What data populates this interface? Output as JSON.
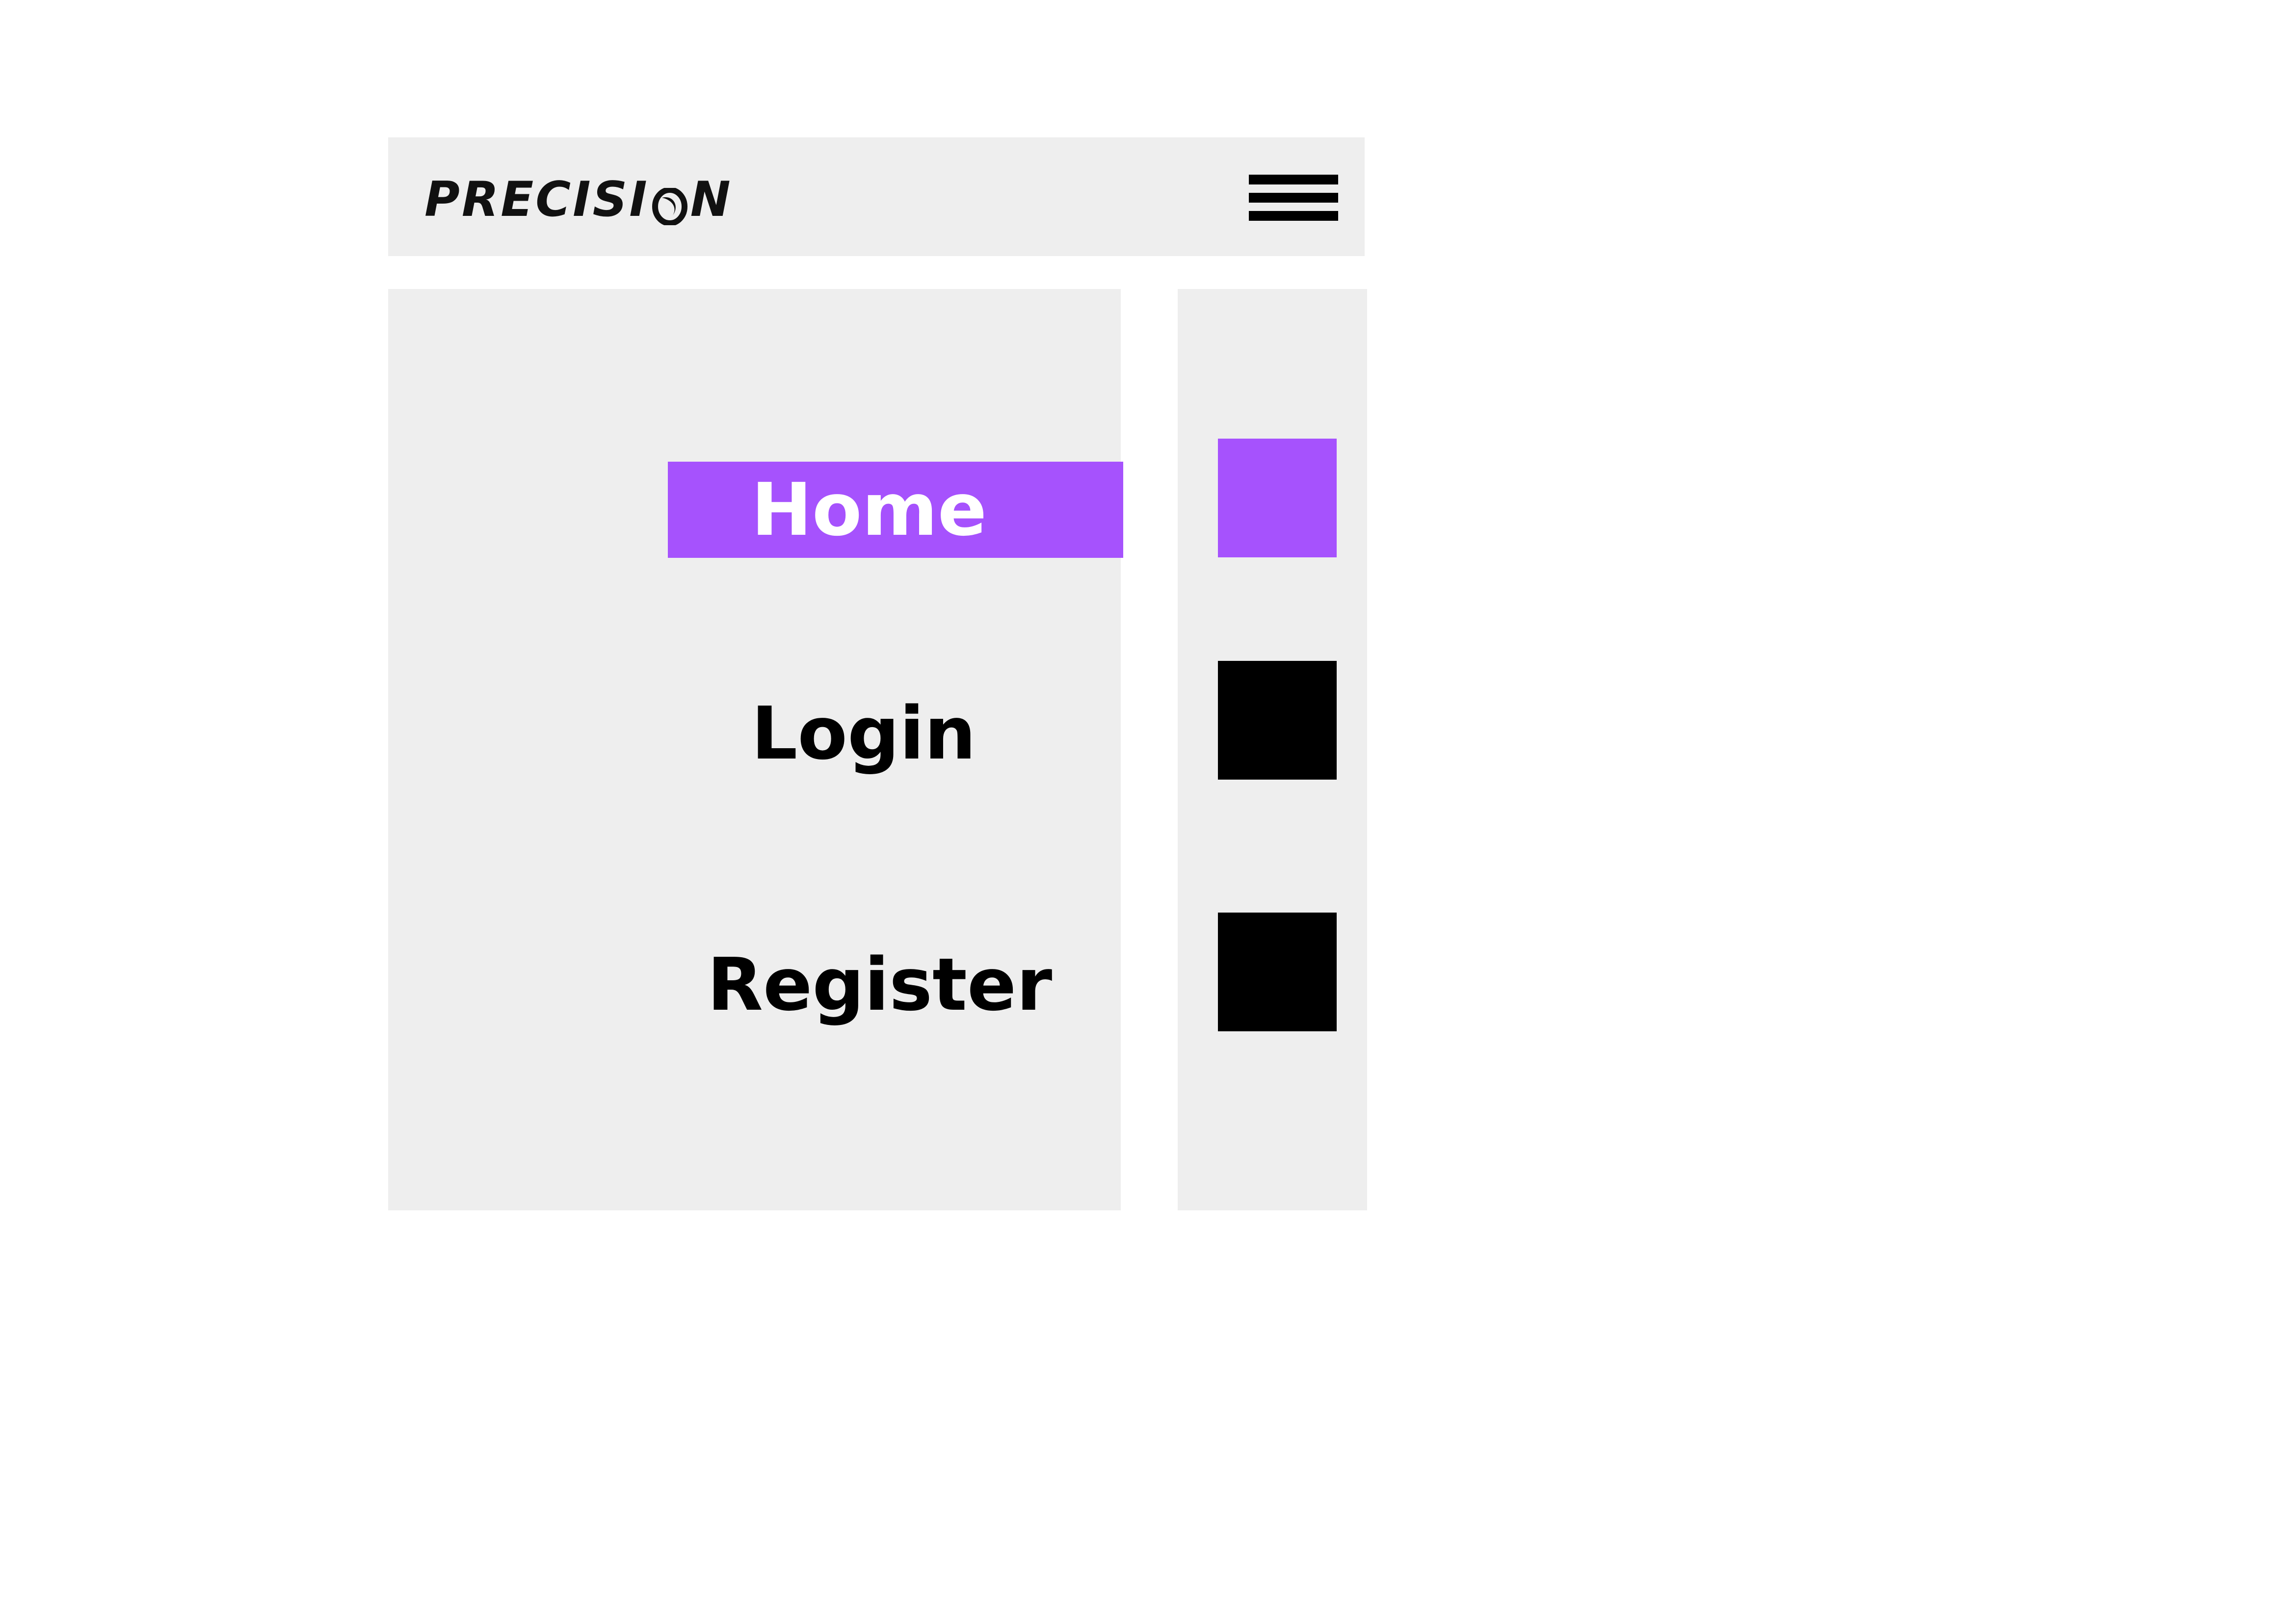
{
  "header": {
    "logo_text_before": "PRECISI",
    "logo_text_after": "N",
    "menu_icon": "hamburger-icon"
  },
  "menu": {
    "items": [
      {
        "label": "Home",
        "active": true
      },
      {
        "label": "Login",
        "active": false
      },
      {
        "label": "Register",
        "active": false
      }
    ]
  },
  "side_icons": {
    "items": [
      {
        "name": "home-square-icon",
        "color": "#a652fd"
      },
      {
        "name": "login-square-icon",
        "color": "#000000"
      },
      {
        "name": "register-square-icon",
        "color": "#000000"
      }
    ]
  },
  "colors": {
    "accent": "#a652fd",
    "panel_bg": "#eeeeee",
    "text": "#000000",
    "active_text": "#ffffff"
  }
}
